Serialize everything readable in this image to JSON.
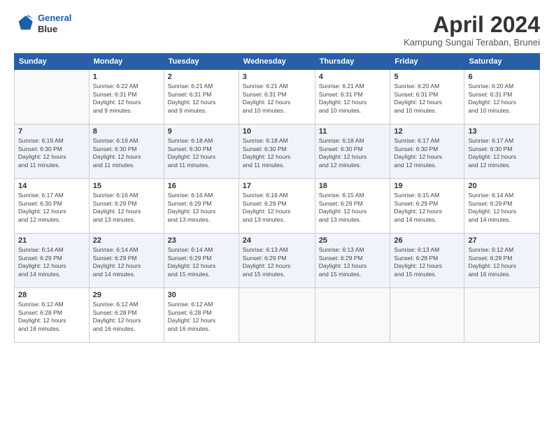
{
  "logo": {
    "line1": "General",
    "line2": "Blue"
  },
  "title": "April 2024",
  "location": "Kampung Sungai Teraban, Brunei",
  "headers": [
    "Sunday",
    "Monday",
    "Tuesday",
    "Wednesday",
    "Thursday",
    "Friday",
    "Saturday"
  ],
  "weeks": [
    [
      {
        "day": "",
        "info": ""
      },
      {
        "day": "1",
        "info": "Sunrise: 6:22 AM\nSunset: 6:31 PM\nDaylight: 12 hours\nand 9 minutes."
      },
      {
        "day": "2",
        "info": "Sunrise: 6:21 AM\nSunset: 6:31 PM\nDaylight: 12 hours\nand 9 minutes."
      },
      {
        "day": "3",
        "info": "Sunrise: 6:21 AM\nSunset: 6:31 PM\nDaylight: 12 hours\nand 10 minutes."
      },
      {
        "day": "4",
        "info": "Sunrise: 6:21 AM\nSunset: 6:31 PM\nDaylight: 12 hours\nand 10 minutes."
      },
      {
        "day": "5",
        "info": "Sunrise: 6:20 AM\nSunset: 6:31 PM\nDaylight: 12 hours\nand 10 minutes."
      },
      {
        "day": "6",
        "info": "Sunrise: 6:20 AM\nSunset: 6:31 PM\nDaylight: 12 hours\nand 10 minutes."
      }
    ],
    [
      {
        "day": "7",
        "info": "Sunrise: 6:19 AM\nSunset: 6:30 PM\nDaylight: 12 hours\nand 11 minutes."
      },
      {
        "day": "8",
        "info": "Sunrise: 6:19 AM\nSunset: 6:30 PM\nDaylight: 12 hours\nand 11 minutes."
      },
      {
        "day": "9",
        "info": "Sunrise: 6:18 AM\nSunset: 6:30 PM\nDaylight: 12 hours\nand 11 minutes."
      },
      {
        "day": "10",
        "info": "Sunrise: 6:18 AM\nSunset: 6:30 PM\nDaylight: 12 hours\nand 11 minutes."
      },
      {
        "day": "11",
        "info": "Sunrise: 6:18 AM\nSunset: 6:30 PM\nDaylight: 12 hours\nand 12 minutes."
      },
      {
        "day": "12",
        "info": "Sunrise: 6:17 AM\nSunset: 6:30 PM\nDaylight: 12 hours\nand 12 minutes."
      },
      {
        "day": "13",
        "info": "Sunrise: 6:17 AM\nSunset: 6:30 PM\nDaylight: 12 hours\nand 12 minutes."
      }
    ],
    [
      {
        "day": "14",
        "info": "Sunrise: 6:17 AM\nSunset: 6:30 PM\nDaylight: 12 hours\nand 12 minutes."
      },
      {
        "day": "15",
        "info": "Sunrise: 6:16 AM\nSunset: 6:29 PM\nDaylight: 12 hours\nand 13 minutes."
      },
      {
        "day": "16",
        "info": "Sunrise: 6:16 AM\nSunset: 6:29 PM\nDaylight: 12 hours\nand 13 minutes."
      },
      {
        "day": "17",
        "info": "Sunrise: 6:16 AM\nSunset: 6:29 PM\nDaylight: 12 hours\nand 13 minutes."
      },
      {
        "day": "18",
        "info": "Sunrise: 6:15 AM\nSunset: 6:29 PM\nDaylight: 12 hours\nand 13 minutes."
      },
      {
        "day": "19",
        "info": "Sunrise: 6:15 AM\nSunset: 6:29 PM\nDaylight: 12 hours\nand 14 minutes."
      },
      {
        "day": "20",
        "info": "Sunrise: 6:14 AM\nSunset: 6:29 PM\nDaylight: 12 hours\nand 14 minutes."
      }
    ],
    [
      {
        "day": "21",
        "info": "Sunrise: 6:14 AM\nSunset: 6:29 PM\nDaylight: 12 hours\nand 14 minutes."
      },
      {
        "day": "22",
        "info": "Sunrise: 6:14 AM\nSunset: 6:29 PM\nDaylight: 12 hours\nand 14 minutes."
      },
      {
        "day": "23",
        "info": "Sunrise: 6:14 AM\nSunset: 6:29 PM\nDaylight: 12 hours\nand 15 minutes."
      },
      {
        "day": "24",
        "info": "Sunrise: 6:13 AM\nSunset: 6:29 PM\nDaylight: 12 hours\nand 15 minutes."
      },
      {
        "day": "25",
        "info": "Sunrise: 6:13 AM\nSunset: 6:29 PM\nDaylight: 12 hours\nand 15 minutes."
      },
      {
        "day": "26",
        "info": "Sunrise: 6:13 AM\nSunset: 6:28 PM\nDaylight: 12 hours\nand 15 minutes."
      },
      {
        "day": "27",
        "info": "Sunrise: 6:12 AM\nSunset: 6:28 PM\nDaylight: 12 hours\nand 16 minutes."
      }
    ],
    [
      {
        "day": "28",
        "info": "Sunrise: 6:12 AM\nSunset: 6:28 PM\nDaylight: 12 hours\nand 16 minutes."
      },
      {
        "day": "29",
        "info": "Sunrise: 6:12 AM\nSunset: 6:28 PM\nDaylight: 12 hours\nand 16 minutes."
      },
      {
        "day": "30",
        "info": "Sunrise: 6:12 AM\nSunset: 6:28 PM\nDaylight: 12 hours\nand 16 minutes."
      },
      {
        "day": "",
        "info": ""
      },
      {
        "day": "",
        "info": ""
      },
      {
        "day": "",
        "info": ""
      },
      {
        "day": "",
        "info": ""
      }
    ]
  ]
}
